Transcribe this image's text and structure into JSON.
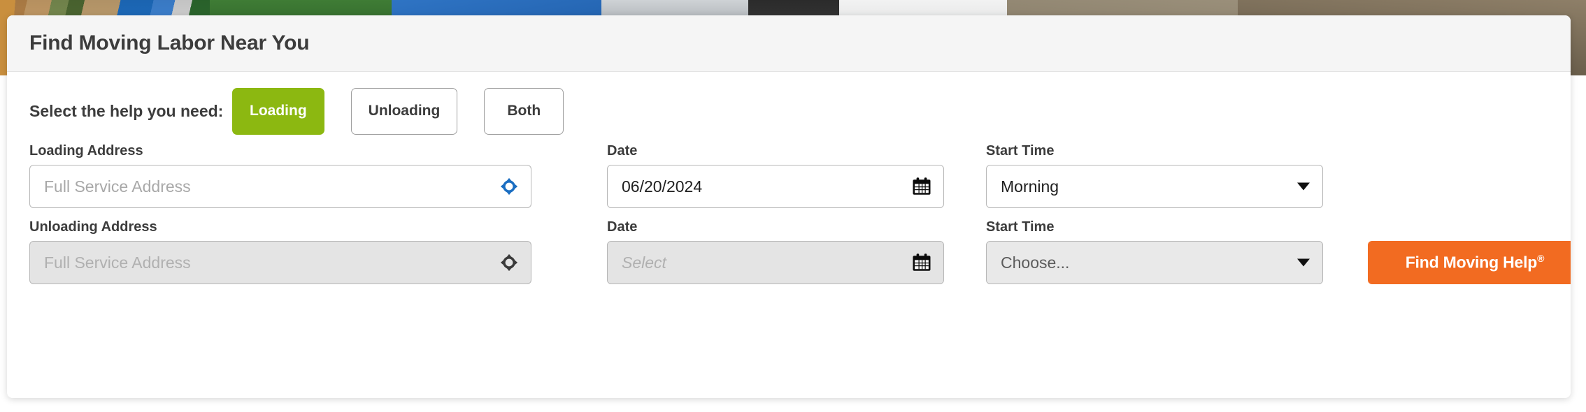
{
  "card": {
    "title": "Find Moving Labor Near You"
  },
  "help_selector": {
    "label": "Select the help you need:",
    "options": [
      {
        "label": "Loading",
        "selected": true
      },
      {
        "label": "Unloading",
        "selected": false
      },
      {
        "label": "Both",
        "selected": false
      }
    ]
  },
  "fields": {
    "loading_address": {
      "label": "Loading Address",
      "value": "",
      "placeholder": "Full Service Address",
      "icon": "crosshair-location-icon",
      "icon_color": "#1b6ec2",
      "disabled": false
    },
    "unloading_address": {
      "label": "Unloading Address",
      "value": "",
      "placeholder": "Full Service Address",
      "icon": "crosshair-location-icon",
      "icon_color": "#3a3a3a",
      "disabled": true
    },
    "loading_date": {
      "label": "Date",
      "value": "06/20/2024",
      "placeholder": "",
      "icon": "calendar-icon",
      "disabled": false
    },
    "unloading_date": {
      "label": "Date",
      "value": "",
      "placeholder": "Select",
      "icon": "calendar-icon",
      "disabled": true
    },
    "loading_start_time": {
      "label": "Start Time",
      "value": "Morning",
      "icon": "chevron-down-icon",
      "disabled": false
    },
    "unloading_start_time": {
      "label": "Start Time",
      "value": "Choose...",
      "icon": "chevron-down-icon",
      "disabled": true
    }
  },
  "submit": {
    "label": "Find Moving Help",
    "superscript": "®"
  },
  "colors": {
    "accent_green": "#8cb811",
    "accent_orange": "#f26b21",
    "header_bg": "#f5f5f5",
    "disabled_bg": "#e4e4e4",
    "text": "#3c3c3c",
    "icon_blue": "#1b6ec2"
  }
}
